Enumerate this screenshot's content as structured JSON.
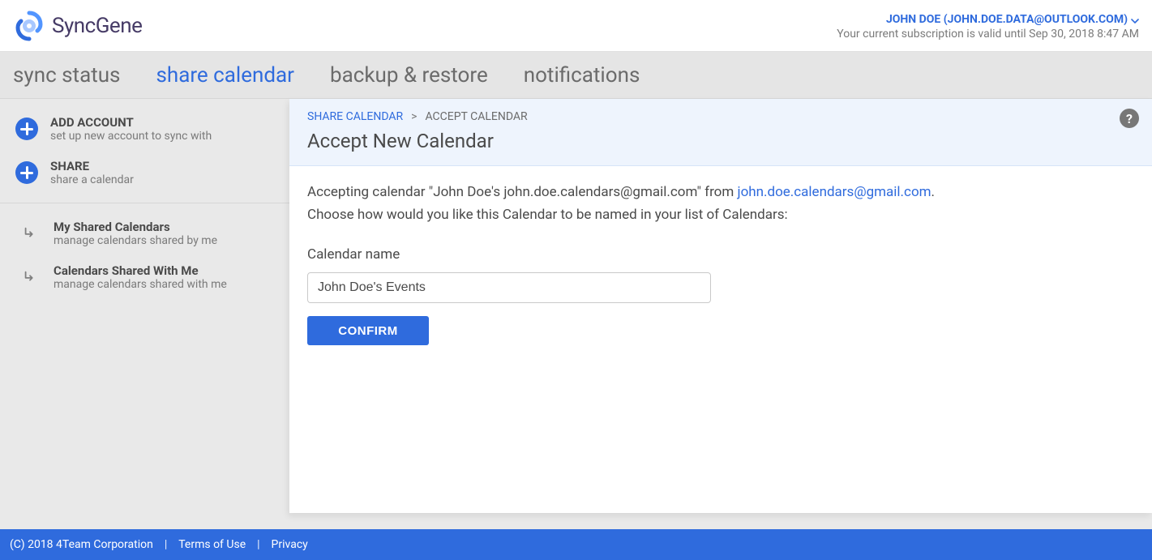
{
  "brand": {
    "name": "SyncGene"
  },
  "header": {
    "user_label": "JOHN DOE (JOHN.DOE.DATA@OUTLOOK.COM)",
    "subscription_text": "Your current subscription is valid until Sep 30, 2018 8:47 AM"
  },
  "tabs": {
    "sync_status": "sync status",
    "share_calendar": "share calendar",
    "backup_restore": "backup & restore",
    "notifications": "notifications"
  },
  "sidebar": {
    "add_account": {
      "title": "ADD ACCOUNT",
      "sub": "set up new account to sync with"
    },
    "share": {
      "title": "SHARE",
      "sub": "share a calendar"
    },
    "my_shared": {
      "title": "My Shared Calendars",
      "sub": "manage calendars shared by me"
    },
    "shared_with_me": {
      "title": "Calendars Shared With Me",
      "sub": "manage calendars shared with me"
    }
  },
  "panel": {
    "breadcrumb_parent": "SHARE CALENDAR",
    "breadcrumb_current": "ACCEPT CALENDAR",
    "title": "Accept New Calendar",
    "msg_prefix": "Accepting calendar \"John Doe's john.doe.calendars@gmail.com\" from ",
    "msg_email": "john.doe.calendars@gmail.com",
    "msg_suffix": ".",
    "msg_line2": "Choose how would you like this Calendar to be named in your list of Calendars:",
    "field_label": "Calendar name",
    "field_value": "John Doe's Events",
    "confirm_label": "CONFIRM"
  },
  "footer": {
    "copyright": "(C) 2018  4Team Corporation",
    "terms": "Terms of Use",
    "privacy": "Privacy"
  }
}
